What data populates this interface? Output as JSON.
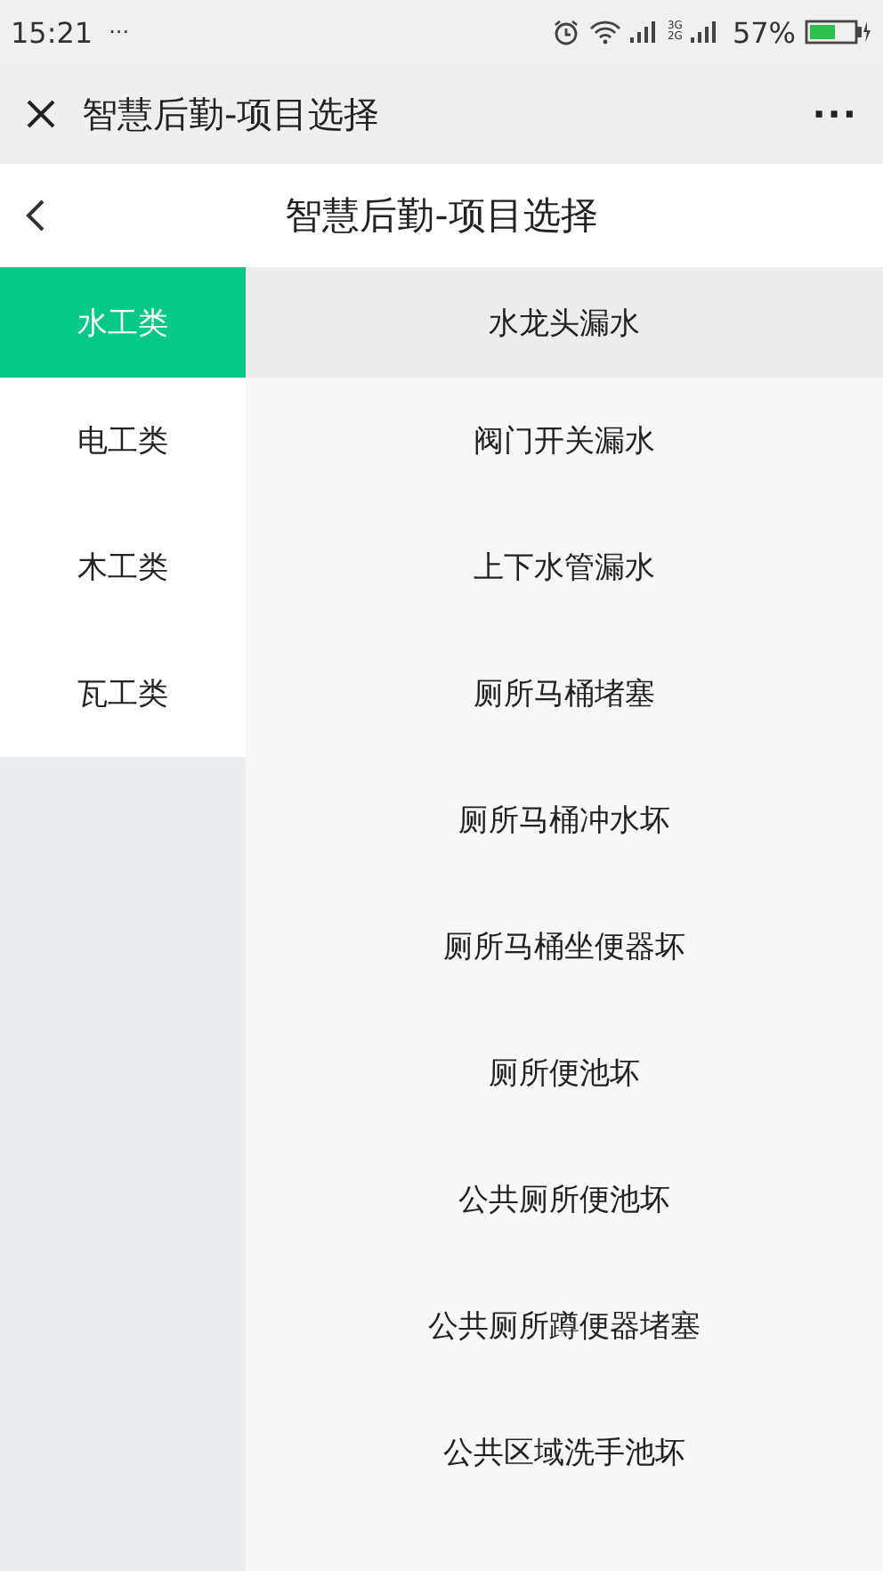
{
  "status_bar": {
    "time": "15:21",
    "dots": "···",
    "network_labels": [
      "3G",
      "2G"
    ],
    "battery": "57%"
  },
  "window": {
    "title": "智慧后勤-项目选择",
    "more": "···"
  },
  "header": {
    "title": "智慧后勤-项目选择"
  },
  "categories": [
    {
      "label": "水工类",
      "selected": true
    },
    {
      "label": "电工类",
      "selected": false
    },
    {
      "label": "木工类",
      "selected": false
    },
    {
      "label": "瓦工类",
      "selected": false
    }
  ],
  "items": [
    {
      "label": "水龙头漏水",
      "selected": true
    },
    {
      "label": "阀门开关漏水",
      "selected": false
    },
    {
      "label": "上下水管漏水",
      "selected": false
    },
    {
      "label": "厕所马桶堵塞",
      "selected": false
    },
    {
      "label": "厕所马桶冲水坏",
      "selected": false
    },
    {
      "label": "厕所马桶坐便器坏",
      "selected": false
    },
    {
      "label": "厕所便池坏",
      "selected": false
    },
    {
      "label": "公共厕所便池坏",
      "selected": false
    },
    {
      "label": "公共厕所蹲便器堵塞",
      "selected": false
    },
    {
      "label": "公共区域洗手池坏",
      "selected": false
    }
  ]
}
